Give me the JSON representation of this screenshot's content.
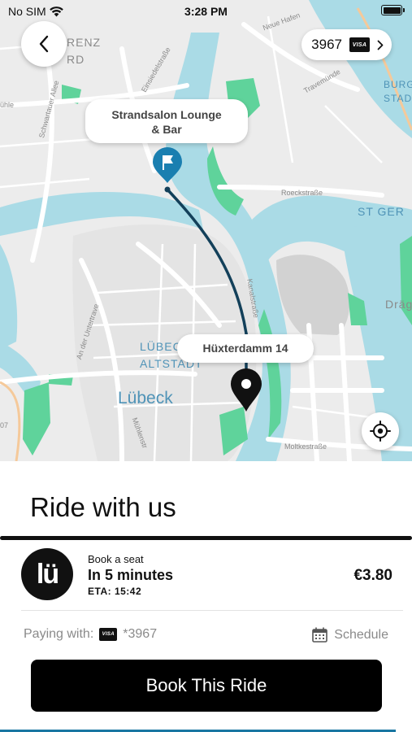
{
  "status_bar": {
    "carrier": "No SIM",
    "time": "3:28 PM"
  },
  "map": {
    "labels": {
      "area_top_left": "RENZ\nRD",
      "altstadt": "LÜBECK\nALTSTADT",
      "city": "Lübeck",
      "st_ger": "ST GER",
      "burg": "BURG\nSTADT",
      "drag": "Dräg",
      "huhle": "ühle",
      "num_07": "07"
    },
    "streets": {
      "schwartauer": "Schwartauer Allee",
      "roeckstrasse": "Roeckstraße",
      "moltkestrasse": "Moltkestraße",
      "untertrave": "An der Untertrave",
      "travemuende": "Travemünde",
      "neue_hafen": "Neue Hafen",
      "muehlenstr": "Mühlenstr",
      "einsiedelstrasse": "Einsiedelstraße",
      "kanalstrasse": "Kanalstraße"
    },
    "destination_callout": "Strandsalon Lounge\n& Bar",
    "origin_callout": "Hüxterdamm 14"
  },
  "payment_pill": {
    "card_last4": "3967",
    "card_brand": "VISA"
  },
  "sheet": {
    "title": "Ride with us",
    "ride": {
      "logo_text": "lü",
      "kind": "Book a seat",
      "time": "In 5 minutes",
      "eta": "ETA: 15:42",
      "price": "€3.80"
    },
    "paying_label": "Paying with:",
    "paying_brand": "VISA",
    "paying_card": "*3967",
    "schedule_label": "Schedule",
    "book_button": "Book This Ride"
  },
  "colors": {
    "water": "#aadbe6",
    "park": "#5fd39b",
    "route": "#13405a",
    "destination_pin": "#1a7fb0",
    "origin_pin": "#111111",
    "accent": "#1976a2"
  }
}
